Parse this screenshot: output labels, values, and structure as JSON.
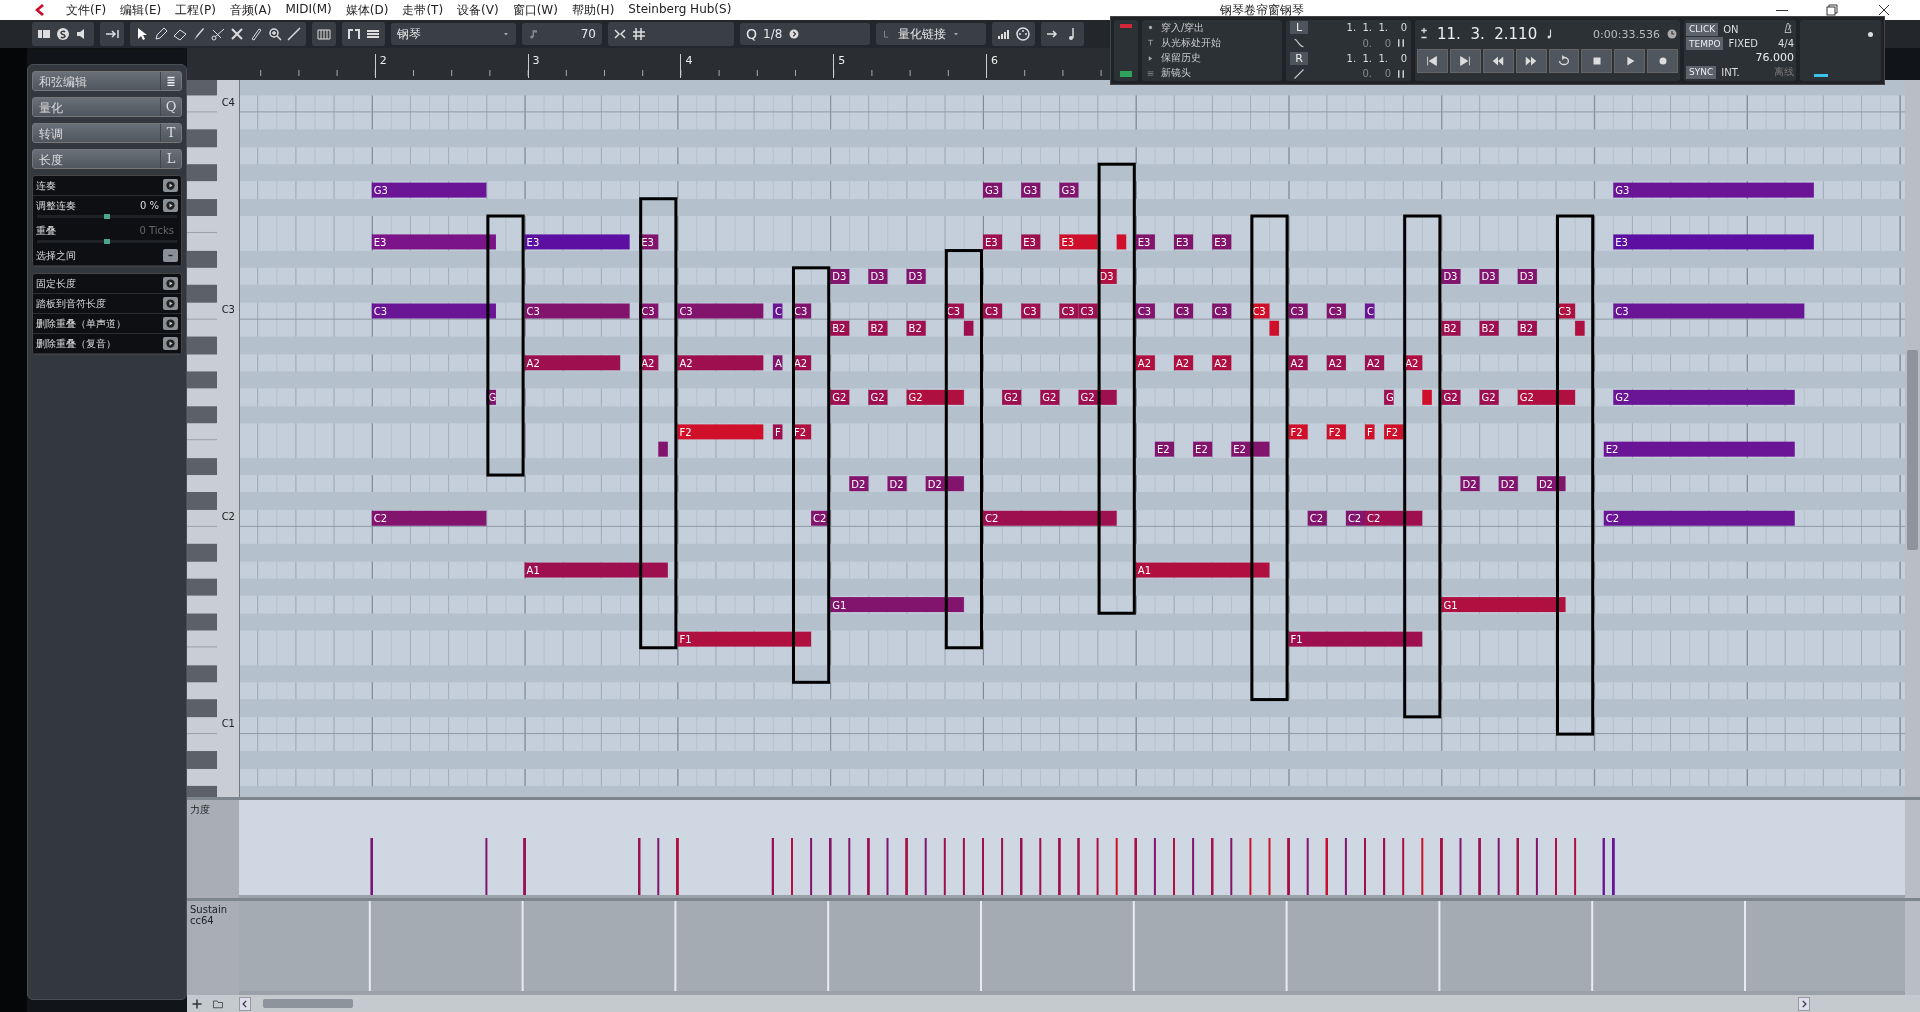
{
  "window": {
    "title": "钢琴卷帘窗钢琴"
  },
  "menu": [
    "文件(F)",
    "编辑(E)",
    "工程(P)",
    "音频(A)",
    "MIDI(M)",
    "媒体(D)",
    "走带(T)",
    "设备(V)",
    "窗口(W)",
    "帮助(H)",
    "Steinberg Hub(S)"
  ],
  "toolbar": {
    "instrument": "钢琴",
    "velocity": "70",
    "quantize_label": "Q",
    "quantize": "1/8",
    "quantize_link": "量化链接"
  },
  "transport": {
    "punch_items": [
      "穿入/穿出",
      "从光标处开始",
      "保留历史",
      "新镜头"
    ],
    "left_locator": {
      "label": "L",
      "position": "1.  1.  1.    0",
      "offset": "0.    0"
    },
    "right_locator": {
      "label": "R",
      "position": "1.  1.  1.    0",
      "offset": "0.    0"
    },
    "position": "11.  3.  2.110",
    "time": "0:00:33.536",
    "click_label": "CLICK",
    "click_value": "ON",
    "tempo_label": "TEMPO",
    "tempo_mode": "FIXED",
    "signature": "4/4",
    "tempo": "76.000",
    "sync_label": "SYNC",
    "sync_value": "INT.",
    "offline": "离线"
  },
  "inspector": {
    "sections": [
      {
        "title": "和弦编辑",
        "kind": "icon"
      },
      {
        "title": "量化",
        "key": "Q",
        "kind": "letter"
      },
      {
        "title": "转调",
        "key": "T",
        "kind": "letter"
      },
      {
        "title": "长度",
        "key": "L",
        "kind": "letter"
      }
    ],
    "legato": [
      {
        "kind": "action",
        "label": "连奏"
      },
      {
        "kind": "value",
        "label": "调整连奏",
        "value": "0 %",
        "disabled": false,
        "level": 0.5
      },
      {
        "kind": "value",
        "label": "重叠",
        "value": "0 Ticks",
        "disabled": true,
        "level": 0.5
      },
      {
        "kind": "toggle",
        "label": "选择之间"
      }
    ],
    "actions": [
      "固定长度",
      "踏板到音符长度",
      "删除重叠（单声道）",
      "删除重叠（复音）"
    ]
  },
  "bar_numbers": [
    "2",
    "3",
    "4",
    "5",
    "6"
  ],
  "key_labels": [
    "C4",
    "C3",
    "C2",
    "C1"
  ],
  "notes": [
    {
      "label": "G3",
      "color": "#6a1496"
    },
    {
      "label": "E3",
      "color": "#7a1488"
    },
    {
      "label": "C3",
      "color": "#6a1496"
    },
    {
      "label": "G",
      "color": "#82146e"
    },
    {
      "label": "C2",
      "color": "#82146e"
    },
    {
      "label": "E3",
      "color": "#5c0fa0"
    },
    {
      "label": "C3",
      "color": "#82146e"
    },
    {
      "label": "A2",
      "color": "#9e0f50"
    },
    {
      "label": "A1",
      "color": "#9e0f50"
    },
    {
      "label": "E3",
      "color": "#82146e"
    },
    {
      "label": "C3",
      "color": "#82146e"
    },
    {
      "label": "A2",
      "color": "#9e0f50"
    },
    {
      "color": "#82146e"
    },
    {
      "label": "C3",
      "color": "#82146e"
    },
    {
      "label": "A2",
      "color": "#9e0f50"
    },
    {
      "label": "F2",
      "color": "#d0102a"
    },
    {
      "label": "F1",
      "color": "#b01040"
    },
    {
      "label": "C",
      "color": "#6a1496"
    },
    {
      "label": "A",
      "color": "#82146e"
    },
    {
      "label": "F",
      "color": "#9e0f50"
    },
    {
      "label": "C3",
      "color": "#82146e"
    },
    {
      "label": "A2",
      "color": "#9e0f50"
    },
    {
      "label": "F2",
      "color": "#b01040"
    },
    {
      "label": "C2",
      "color": "#82146e"
    },
    {
      "label": "D3",
      "color": "#82146e"
    },
    {
      "label": "D3",
      "color": "#82146e"
    },
    {
      "label": "D3",
      "color": "#82146e"
    },
    {
      "label": "B2",
      "color": "#9e0f50"
    },
    {
      "label": "B2",
      "color": "#9e0f50"
    },
    {
      "label": "B2",
      "color": "#9e0f50"
    },
    {
      "label": "G2",
      "color": "#9e0f50"
    },
    {
      "label": "G2",
      "color": "#9e0f50"
    },
    {
      "label": "G2",
      "color": "#b01040"
    },
    {
      "label": "D2",
      "color": "#82146e"
    },
    {
      "label": "D2",
      "color": "#82146e"
    },
    {
      "label": "D2",
      "color": "#82146e"
    },
    {
      "label": "G1",
      "color": "#82146e"
    },
    {
      "label": "C3",
      "color": "#9e0f50"
    },
    {
      "color": "#9e0f50"
    },
    {
      "label": "G3",
      "color": "#82146e"
    },
    {
      "label": "G3",
      "color": "#82146e"
    },
    {
      "label": "G3",
      "color": "#82146e"
    },
    {
      "label": "E3",
      "color": "#9e0f50"
    },
    {
      "label": "E3",
      "color": "#9e0f50"
    },
    {
      "label": "E3",
      "color": "#d0102a"
    },
    {
      "color": "#d0102a"
    },
    {
      "label": "C3",
      "color": "#9e0f50"
    },
    {
      "label": "C3",
      "color": "#9e0f50"
    },
    {
      "label": "C3",
      "color": "#9e0f50"
    },
    {
      "label": "C3",
      "color": "#9e0f50"
    },
    {
      "label": "G2",
      "color": "#9e0f50"
    },
    {
      "label": "G2",
      "color": "#9e0f50"
    },
    {
      "label": "G2",
      "color": "#9e0f50"
    },
    {
      "label": "C2",
      "color": "#9e0f50"
    },
    {
      "label": "D3",
      "color": "#b01040"
    },
    {
      "label": "E3",
      "color": "#82146e"
    },
    {
      "label": "E3",
      "color": "#82146e"
    },
    {
      "label": "E3",
      "color": "#82146e"
    },
    {
      "label": "C3",
      "color": "#82146e"
    },
    {
      "label": "C3",
      "color": "#82146e"
    },
    {
      "label": "C3",
      "color": "#82146e"
    },
    {
      "label": "C3",
      "color": "#d0102a"
    },
    {
      "label": "A2",
      "color": "#b01040"
    },
    {
      "label": "A2",
      "color": "#b01040"
    },
    {
      "label": "A2",
      "color": "#b01040"
    },
    {
      "label": "E2",
      "color": "#82146e"
    },
    {
      "label": "E2",
      "color": "#82146e"
    },
    {
      "label": "E2",
      "color": "#82146e"
    },
    {
      "label": "A1",
      "color": "#b01040"
    },
    {
      "color": "#d0102a"
    },
    {
      "label": "C3",
      "color": "#82146e"
    },
    {
      "label": "C3",
      "color": "#82146e"
    },
    {
      "label": "C",
      "color": "#6a1496"
    },
    {
      "label": "A2",
      "color": "#9e0f50"
    },
    {
      "label": "A2",
      "color": "#9e0f50"
    },
    {
      "label": "A2",
      "color": "#9e0f50"
    },
    {
      "label": "A2",
      "color": "#b01040"
    },
    {
      "label": "F2",
      "color": "#d0102a"
    },
    {
      "label": "F2",
      "color": "#d0102a"
    },
    {
      "label": "F",
      "color": "#d0102a"
    },
    {
      "label": "F2",
      "color": "#d0102a"
    },
    {
      "label": "G",
      "color": "#9e0f50"
    },
    {
      "color": "#d0102a"
    },
    {
      "label": "C2",
      "color": "#82146e"
    },
    {
      "label": "C2",
      "color": "#82146e"
    },
    {
      "label": "C2",
      "color": "#9e0f50"
    },
    {
      "label": "F1",
      "color": "#9e0f50"
    },
    {
      "label": "D3",
      "color": "#82146e"
    },
    {
      "label": "D3",
      "color": "#82146e"
    },
    {
      "label": "D3",
      "color": "#82146e"
    },
    {
      "label": "B2",
      "color": "#9e0f50"
    },
    {
      "label": "B2",
      "color": "#9e0f50"
    },
    {
      "label": "B2",
      "color": "#9e0f50"
    },
    {
      "label": "G2",
      "color": "#9e0f50"
    },
    {
      "label": "G2",
      "color": "#9e0f50"
    },
    {
      "label": "G2",
      "color": "#b01040"
    },
    {
      "label": "D2",
      "color": "#82146e"
    },
    {
      "label": "D2",
      "color": "#82146e"
    },
    {
      "label": "D2",
      "color": "#82146e"
    },
    {
      "label": "G1",
      "color": "#b01040"
    },
    {
      "label": "C3",
      "color": "#b01040"
    },
    {
      "color": "#b01040"
    },
    {
      "label": "G3",
      "color": "#6a1496"
    },
    {
      "label": "E3",
      "color": "#5c0fa0"
    },
    {
      "label": "C3",
      "color": "#6a1496"
    },
    {
      "label": "G2",
      "color": "#6a1496"
    },
    {
      "label": "E2",
      "color": "#6a1496"
    },
    {
      "label": "C2",
      "color": "#6a1496"
    }
  ],
  "lanes": {
    "velocity_label": "力度",
    "sustain_label": "Sustain",
    "sustain_controller": "cc64"
  }
}
